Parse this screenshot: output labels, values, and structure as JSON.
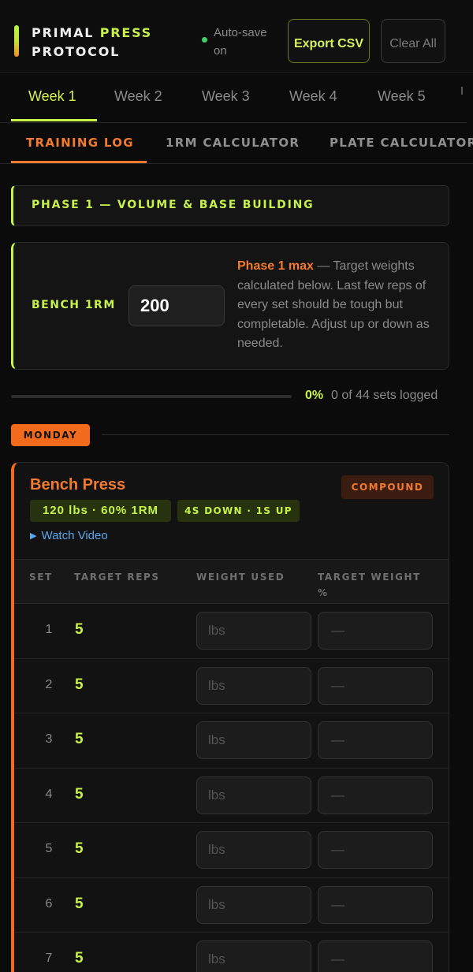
{
  "header": {
    "brand_line1": "PRIMAL",
    "brand_accent": "PRESS",
    "brand_line2": "PROTOCOL",
    "autosave": "Auto-save on",
    "export_label": "Export CSV",
    "clear_label": "Clear All"
  },
  "weeks": [
    {
      "label": "Week 1",
      "active": true
    },
    {
      "label": "Week 2",
      "active": false
    },
    {
      "label": "Week 3",
      "active": false
    },
    {
      "label": "Week 4",
      "active": false
    },
    {
      "label": "Week 5",
      "active": false
    }
  ],
  "sections": [
    {
      "label": "TRAINING LOG",
      "active": true
    },
    {
      "label": "1RM CALCULATOR",
      "active": false
    },
    {
      "label": "PLATE CALCULATOR",
      "active": false
    }
  ],
  "phase": {
    "title": "PHASE 1 — VOLUME & BASE BUILDING"
  },
  "one_rm": {
    "label": "BENCH 1RM",
    "value": "200",
    "desc_highlight": "Phase 1 max",
    "desc_rest": " — Target weights calculated below. Last few reps of every set should be tough but completable. Adjust up or down as needed."
  },
  "progress": {
    "percent": "0%",
    "fraction": 0,
    "text": "0 of 44 sets logged"
  },
  "day": {
    "label": "MONDAY"
  },
  "exercise": {
    "name": "Bench Press",
    "tag": "COMPOUND",
    "chip_weight": "120 lbs · 60% 1RM",
    "chip_tempo": "4S DOWN · 1S UP",
    "video_label": "Watch Video",
    "headers": {
      "set": "SET",
      "reps": "TARGET REPS",
      "weight": "WEIGHT USED",
      "target": "TARGET WEIGHT %"
    },
    "sets": [
      {
        "set": "1",
        "reps": "5",
        "placeholder": "lbs",
        "target": "—"
      },
      {
        "set": "2",
        "reps": "5",
        "placeholder": "lbs",
        "target": "—"
      },
      {
        "set": "3",
        "reps": "5",
        "placeholder": "lbs",
        "target": "—"
      },
      {
        "set": "4",
        "reps": "5",
        "placeholder": "lbs",
        "target": "—"
      },
      {
        "set": "5",
        "reps": "5",
        "placeholder": "lbs",
        "target": "—"
      },
      {
        "set": "6",
        "reps": "5",
        "placeholder": "lbs",
        "target": "—"
      },
      {
        "set": "7",
        "reps": "5",
        "placeholder": "lbs",
        "target": "—"
      }
    ]
  },
  "colors": {
    "accent_green": "#c6f24a",
    "accent_orange": "#f27a2e",
    "link_blue": "#5aa8f0",
    "status_dot": "#3ecf6a"
  }
}
